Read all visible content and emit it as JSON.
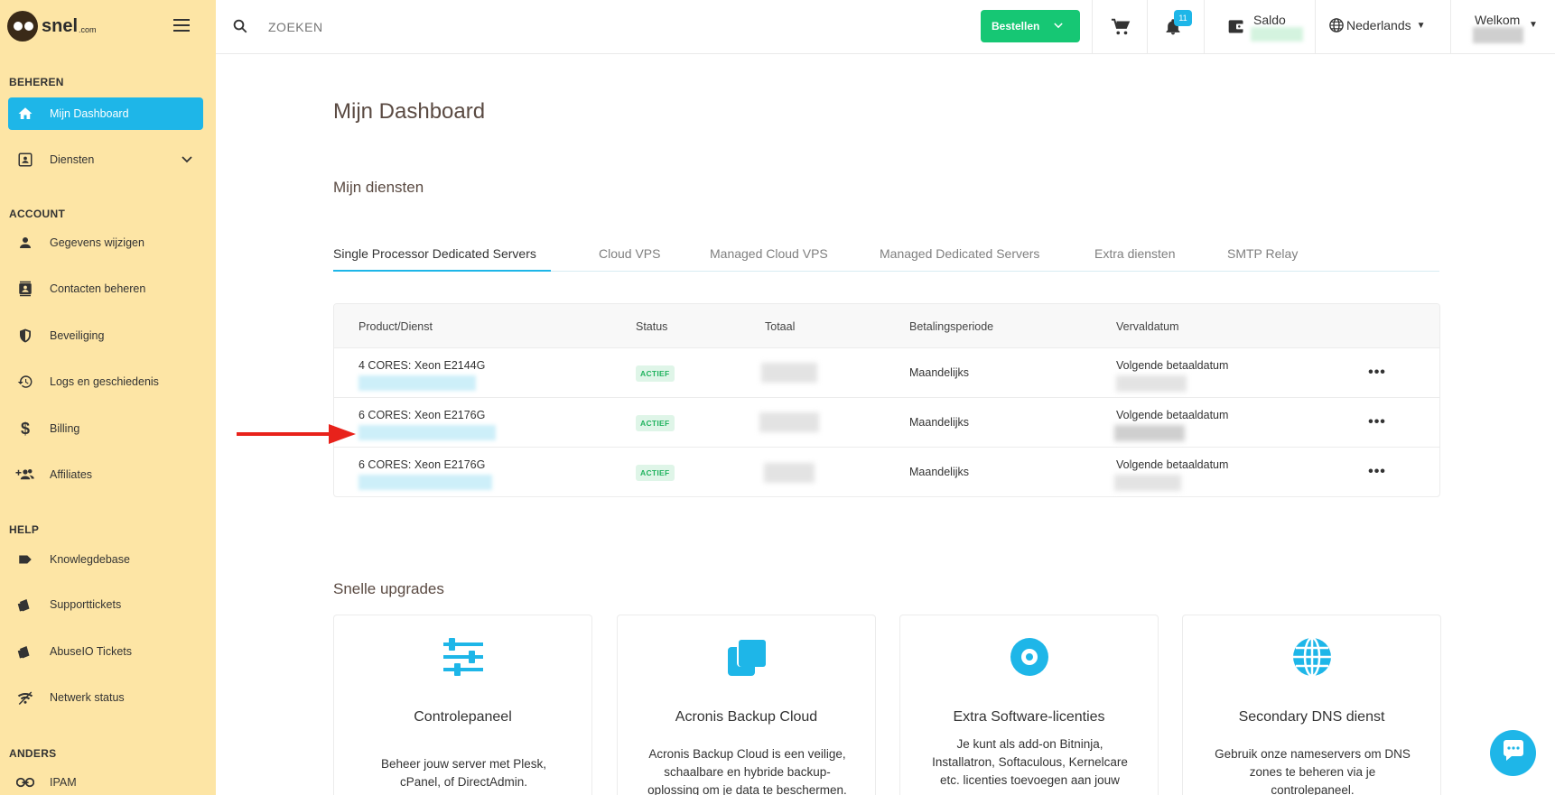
{
  "brand": {
    "name": "snel",
    "suffix": ".com"
  },
  "sidebar": {
    "sections": [
      {
        "title": "BEHEREN"
      },
      {
        "title": "ACCOUNT"
      },
      {
        "title": "HELP"
      },
      {
        "title": "ANDERS"
      }
    ],
    "items": [
      {
        "label": "Mijn Dashboard",
        "icon": "home-icon"
      },
      {
        "label": "Diensten",
        "icon": "id-card-icon"
      },
      {
        "label": "Gegevens wijzigen",
        "icon": "person-icon"
      },
      {
        "label": "Contacten beheren",
        "icon": "contacts-icon"
      },
      {
        "label": "Beveiliging",
        "icon": "shield-icon"
      },
      {
        "label": "Logs en geschiedenis",
        "icon": "history-icon"
      },
      {
        "label": "Billing",
        "icon": "dollar-icon"
      },
      {
        "label": "Affiliates",
        "icon": "group-add-icon"
      },
      {
        "label": "Knowlegdebase",
        "icon": "label-icon"
      },
      {
        "label": "Supporttickets",
        "icon": "ticket-icon"
      },
      {
        "label": "AbuseIO Tickets",
        "icon": "ticket-icon"
      },
      {
        "label": "Netwerk status",
        "icon": "wifi-icon"
      },
      {
        "label": "IPAM",
        "icon": "link-icon"
      }
    ]
  },
  "topbar": {
    "search_placeholder": "ZOEKEN",
    "order_label": "Bestellen",
    "notification_count": "11",
    "saldo_label": "Saldo",
    "language": "Nederlands",
    "welcome": "Welkom"
  },
  "main": {
    "title": "Mijn Dashboard",
    "services_title": "Mijn diensten",
    "tabs": [
      "Single Processor Dedicated Servers",
      "Cloud VPS",
      "Managed Cloud VPS",
      "Managed Dedicated Servers",
      "Extra diensten",
      "SMTP Relay"
    ],
    "table": {
      "headers": [
        "Product/Dienst",
        "Status",
        "Totaal",
        "Betalingsperiode",
        "Vervaldatum"
      ],
      "rows": [
        {
          "product": "4 CORES: Xeon E2144G",
          "status": "ACTIEF",
          "period": "Maandelijks",
          "due": "Volgende betaaldatum"
        },
        {
          "product": "6 CORES: Xeon E2176G",
          "status": "ACTIEF",
          "period": "Maandelijks",
          "due": "Volgende betaaldatum"
        },
        {
          "product": "6 CORES: Xeon E2176G",
          "status": "ACTIEF",
          "period": "Maandelijks",
          "due": "Volgende betaaldatum"
        }
      ]
    },
    "upgrades_title": "Snelle upgrades",
    "upgrades": [
      {
        "title": "Controlepaneel",
        "icon": "sliders-icon",
        "desc_lines": [
          "Beheer jouw server met Plesk,",
          "cPanel, of DirectAdmin."
        ]
      },
      {
        "title": "Acronis Backup Cloud",
        "icon": "copy-icon",
        "desc_lines": [
          "Acronis Backup Cloud is een veilige,",
          "schaalbare en hybride backup-",
          "oplossing om je data te beschermen."
        ]
      },
      {
        "title": "Extra Software-licenties",
        "icon": "disc-icon",
        "desc_lines": [
          "Je kunt als add-on Bitninja,",
          "Installatron, Softaculous, Kernelcare",
          "etc. licenties toevoegen aan jouw"
        ]
      },
      {
        "title": "Secondary DNS dienst",
        "icon": "globe-icon",
        "desc_lines": [
          "Gebruik onze nameservers om DNS",
          "zones te beheren via je",
          "controlepaneel."
        ]
      }
    ]
  },
  "colors": {
    "sidebar_bg": "#fde5a5",
    "accent": "#1eb6e8",
    "order_green": "#16c774",
    "status_green": "#21b35f",
    "arrow_red": "#e8221b"
  }
}
